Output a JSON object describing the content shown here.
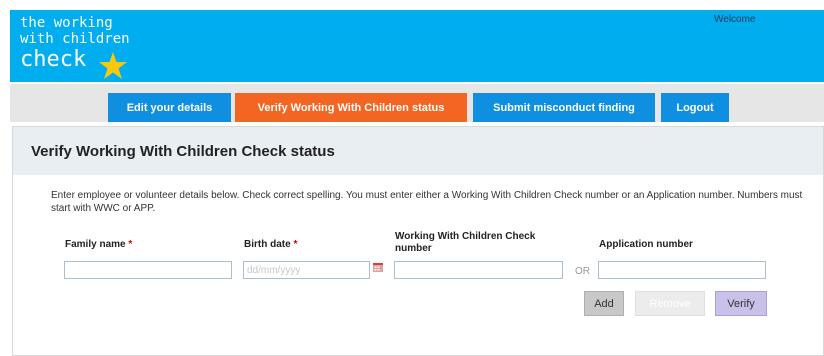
{
  "header": {
    "logo_line1": "the working",
    "logo_line2": "with children",
    "logo_line3": "check",
    "welcome": "Welcome"
  },
  "nav": {
    "tabs": [
      {
        "label": "Edit your details",
        "active": false
      },
      {
        "label": "Verify Working With Children status",
        "active": true
      },
      {
        "label": "Submit misconduct finding",
        "active": false
      },
      {
        "label": "Logout",
        "active": false
      }
    ]
  },
  "panel": {
    "title": "Verify Working With Children Check status",
    "instructions": "Enter employee or volunteer details below. Check correct spelling. You must enter either a Working With Children Check number or an Application number. Numbers must start with WWC or APP."
  },
  "form": {
    "family_name_label": "Family name",
    "birth_date_label": "Birth date",
    "required_marker": "*",
    "wwc_number_label": "Working With Children Check number",
    "application_number_label": "Application number",
    "birth_date_placeholder": "dd/mm/yyyy",
    "or_text": "OR"
  },
  "buttons": {
    "add": "Add",
    "remove": "Remove",
    "verify": "Verify"
  },
  "colors": {
    "header_blue": "#00aeef",
    "tab_blue": "#0f8fe0",
    "tab_active_orange": "#f26522",
    "logo_star": "#f9c80e"
  }
}
